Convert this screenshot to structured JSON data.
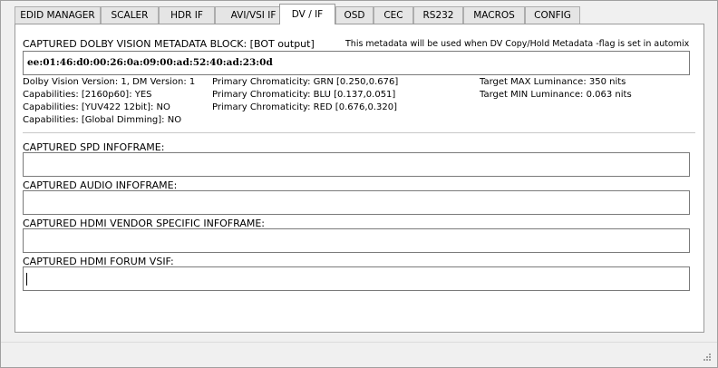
{
  "tabs": [
    {
      "label": "EDID MANAGER",
      "active": false
    },
    {
      "label": "SCALER",
      "active": false
    },
    {
      "label": "HDR IF",
      "active": false
    },
    {
      "label": "AVI/VSI IF",
      "active": false
    },
    {
      "label": "DV / IF",
      "active": true
    },
    {
      "label": "OSD",
      "active": false
    },
    {
      "label": "CEC",
      "active": false
    },
    {
      "label": "RS232",
      "active": false
    },
    {
      "label": "MACROS",
      "active": false
    },
    {
      "label": "CONFIG",
      "active": false
    }
  ],
  "dolby": {
    "title": "CAPTURED DOLBY VISION METADATA BLOCK: [BOT output]",
    "note": "This metadata will be used when DV Copy/Hold Metadata -flag is set in automix",
    "metadata_value": "ee:01:46:d0:00:26:0a:09:00:ad:52:40:ad:23:0d",
    "col1": [
      "Dolby Vision Version: 1, DM Version: 1",
      "Capabilities: [2160p60]: YES",
      "Capabilities: [YUV422 12bit]: NO",
      "Capabilities: [Global Dimming]: NO"
    ],
    "col2": [
      "Primary Chromaticity: GRN [0.250,0.676]",
      "Primary Chromaticity: BLU [0.137,0.051]",
      "Primary Chromaticity: RED [0.676,0.320]"
    ],
    "col3": [
      "Target MAX Luminance: 350 nits",
      "Target MIN Luminance: 0.063 nits"
    ]
  },
  "spd": {
    "title": "CAPTURED SPD INFOFRAME:",
    "value": ""
  },
  "audio": {
    "title": "CAPTURED AUDIO INFOFRAME:",
    "value": ""
  },
  "vendor": {
    "title": "CAPTURED HDMI VENDOR SPECIFIC INFOFRAME:",
    "value": ""
  },
  "forum": {
    "title": "CAPTURED HDMI FORUM VSIF:",
    "value": ""
  }
}
